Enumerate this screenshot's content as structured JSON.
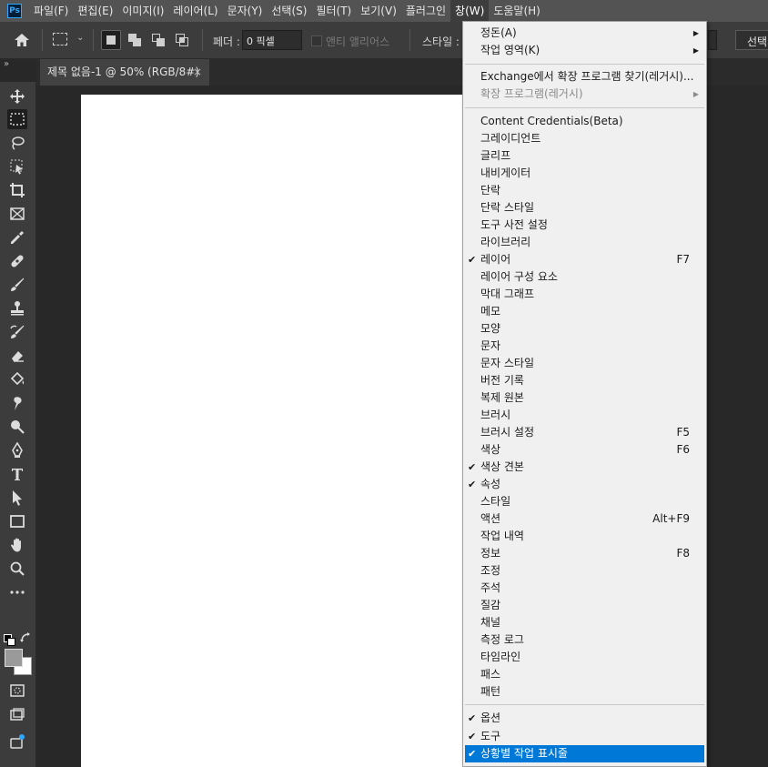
{
  "app": {
    "logo_text": "Ps"
  },
  "menubar": {
    "items": [
      "파일(F)",
      "편집(E)",
      "이미지(I)",
      "레이어(L)",
      "문자(Y)",
      "선택(S)",
      "필터(T)",
      "보기(V)",
      "플러그인",
      "창(W)",
      "도움말(H)"
    ],
    "active_index": 9
  },
  "options": {
    "feather_label": "페더 :",
    "feather_value": "0 픽셀",
    "antialias_label": "앤티 앨리어스",
    "style_label": "스타일 :",
    "select_button": "선택"
  },
  "document_tab": {
    "title": "제목 없음-1 @ 50% (RGB/8#)",
    "close": "×"
  },
  "toolbar": {
    "collapse": "»"
  },
  "window_menu": {
    "top": [
      {
        "label": "정돈(A)",
        "submenu": true
      },
      {
        "label": "작업 영역(K)",
        "submenu": true
      }
    ],
    "extensions": [
      {
        "label": "Exchange에서 확장 프로그램 찾기(레거시)...",
        "disabled": false
      },
      {
        "label": "확장 프로그램(레거시)",
        "disabled": true,
        "submenu": true
      }
    ],
    "panels": [
      {
        "label": "Content Credentials(Beta)"
      },
      {
        "label": "그레이디언트"
      },
      {
        "label": "글리프"
      },
      {
        "label": "내비게이터"
      },
      {
        "label": "단락"
      },
      {
        "label": "단락 스타일"
      },
      {
        "label": "도구 사전 설정"
      },
      {
        "label": "라이브러리"
      },
      {
        "label": "레이어",
        "checked": true,
        "shortcut": "F7"
      },
      {
        "label": "레이어 구성 요소"
      },
      {
        "label": "막대 그래프"
      },
      {
        "label": "메모"
      },
      {
        "label": "모양"
      },
      {
        "label": "문자"
      },
      {
        "label": "문자 스타일"
      },
      {
        "label": "버전 기록"
      },
      {
        "label": "복제 원본"
      },
      {
        "label": "브러시"
      },
      {
        "label": "브러시 설정",
        "shortcut": "F5"
      },
      {
        "label": "색상",
        "shortcut": "F6"
      },
      {
        "label": "색상 견본",
        "checked": true
      },
      {
        "label": "속성",
        "checked": true
      },
      {
        "label": "스타일"
      },
      {
        "label": "액션",
        "shortcut": "Alt+F9"
      },
      {
        "label": "작업 내역"
      },
      {
        "label": "정보",
        "shortcut": "F8"
      },
      {
        "label": "조정"
      },
      {
        "label": "주석"
      },
      {
        "label": "질감"
      },
      {
        "label": "채널"
      },
      {
        "label": "측정 로그"
      },
      {
        "label": "타임라인"
      },
      {
        "label": "패스"
      },
      {
        "label": "패턴"
      }
    ],
    "bottom": [
      {
        "label": "옵션",
        "checked": true
      },
      {
        "label": "도구",
        "checked": true
      },
      {
        "label": "상황별 작업 표시줄",
        "checked": true,
        "highlighted": true
      }
    ]
  },
  "icons": {
    "check": "✔",
    "submenu_arrow": "▶"
  }
}
